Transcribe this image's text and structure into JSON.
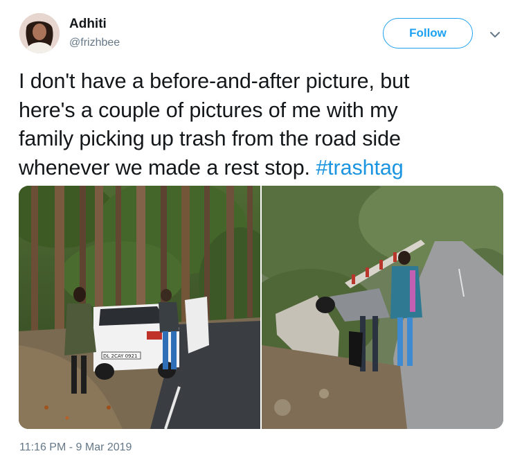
{
  "user": {
    "name": "Adhiti",
    "handle": "@frizhbee"
  },
  "follow_label": "Follow",
  "tweet": {
    "lines": [
      "I don't have a before-and-after picture, but",
      "here's a couple of pictures of me with my",
      "family picking up trash from the road side",
      "whenever we made a rest stop. "
    ],
    "hashtag": "#trashtag"
  },
  "media": {
    "photo1": {
      "plate": "DL 2CAY 0921"
    }
  },
  "timestamp": "11:16 PM - 9 Mar 2019",
  "colors": {
    "accent": "#1da1f2",
    "hashtag": "#1b95e0",
    "secondary_text": "#657786"
  },
  "icons": [
    "avatar",
    "chevron-down-icon"
  ]
}
